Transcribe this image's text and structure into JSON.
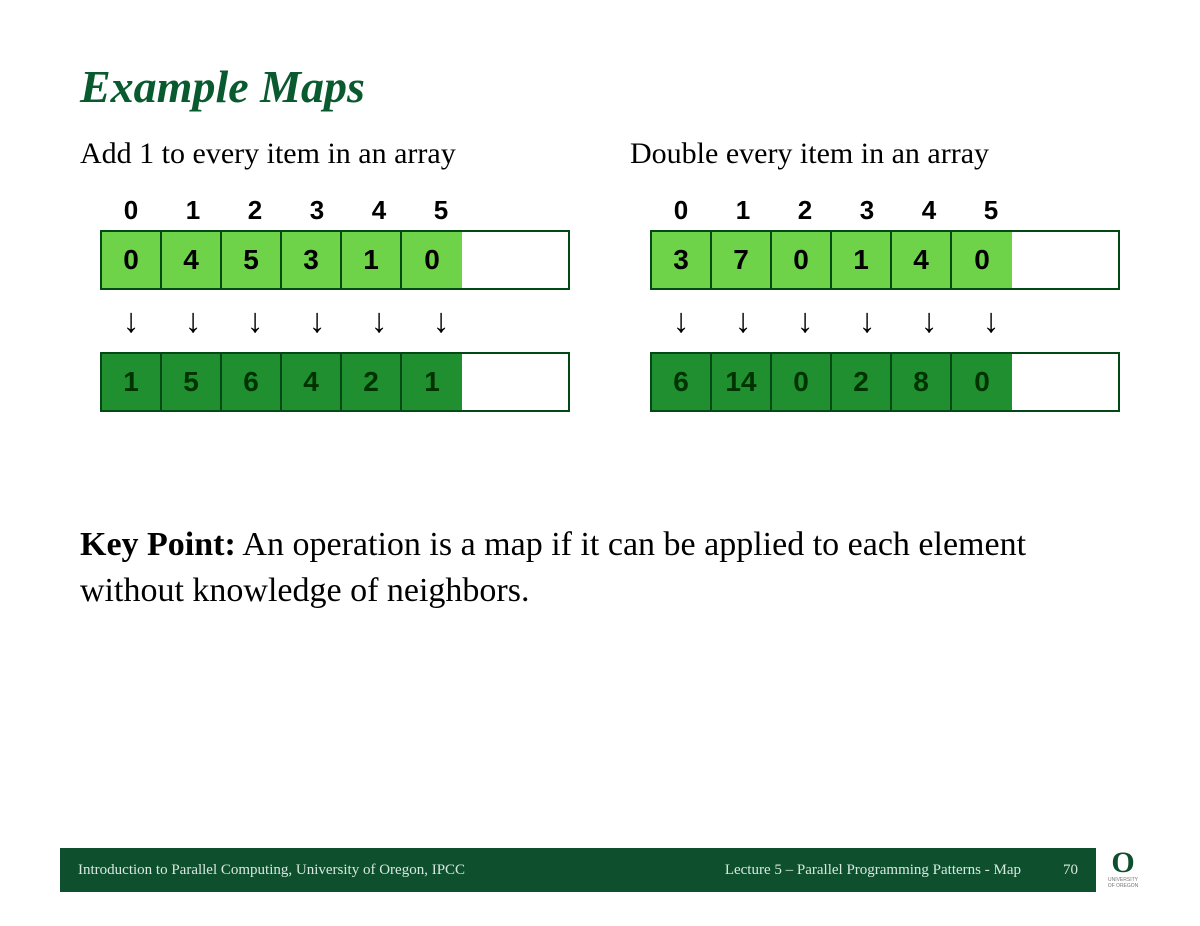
{
  "title": "Example Maps",
  "left": {
    "subtitle": "Add 1 to every item in an array",
    "indices": [
      "0",
      "1",
      "2",
      "3",
      "4",
      "5"
    ],
    "input": [
      "0",
      "4",
      "5",
      "3",
      "1",
      "0"
    ],
    "output": [
      "1",
      "5",
      "6",
      "4",
      "2",
      "1"
    ]
  },
  "right": {
    "subtitle": "Double every item in an array",
    "indices": [
      "0",
      "1",
      "2",
      "3",
      "4",
      "5"
    ],
    "input": [
      "3",
      "7",
      "0",
      "1",
      "4",
      "0"
    ],
    "output": [
      "6",
      "14",
      "0",
      "2",
      "8",
      "0"
    ]
  },
  "arrow_glyph": "↓",
  "keypoint": {
    "label": "Key Point:",
    "text": " An operation is a map if it can be applied to each element without knowledge of neighbors."
  },
  "footer": {
    "course": "Introduction to Parallel Computing, University of Oregon, IPCC",
    "lecture": "Lecture 5 – Parallel Programming Patterns - Map",
    "page": "70",
    "logo_glyph": "O",
    "logo_sub": "UNIVERSITY OF OREGON"
  }
}
